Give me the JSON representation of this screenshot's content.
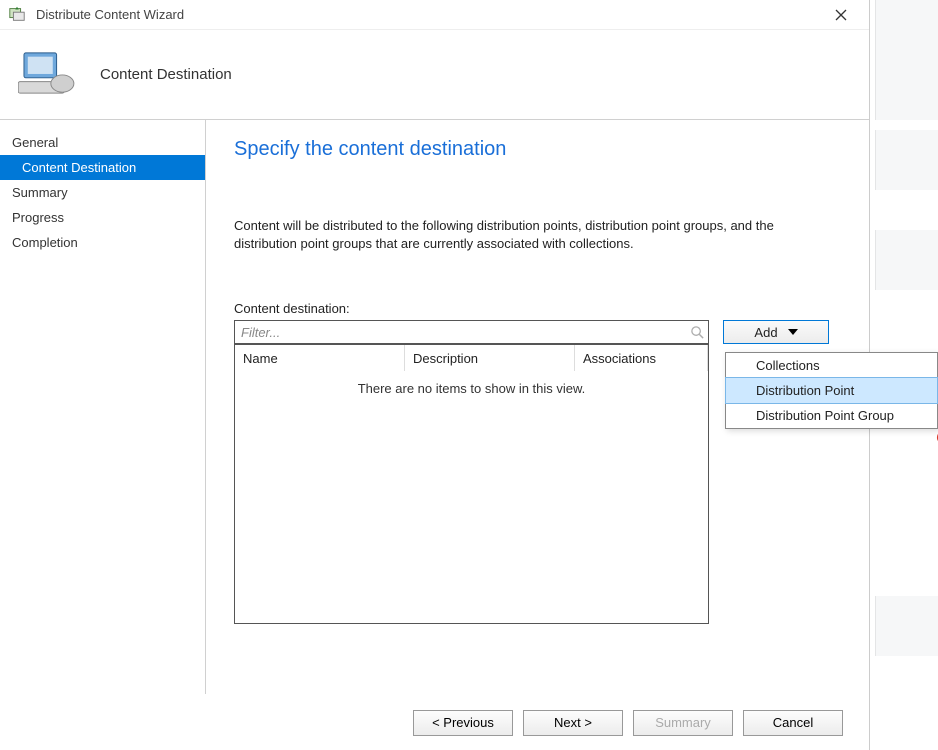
{
  "window": {
    "title": "Distribute Content Wizard",
    "close_aria": "Close"
  },
  "banner": {
    "title": "Content Destination"
  },
  "steps": {
    "items": [
      {
        "label": "General",
        "selected": false
      },
      {
        "label": "Content Destination",
        "selected": true
      },
      {
        "label": "Summary",
        "selected": false
      },
      {
        "label": "Progress",
        "selected": false
      },
      {
        "label": "Completion",
        "selected": false
      }
    ]
  },
  "page": {
    "heading": "Specify the content destination",
    "instructions": "Content will be distributed to the following distribution points, distribution point groups, and the distribution point groups that are currently associated with collections.",
    "field_label": "Content destination:",
    "filter_placeholder": "Filter...",
    "add_label": "Add",
    "columns": {
      "name": "Name",
      "description": "Description",
      "associations": "Associations"
    },
    "empty_text": "There are no items to show in this view."
  },
  "add_menu": {
    "items": [
      {
        "label": "Collections",
        "hover": false
      },
      {
        "label": "Distribution Point",
        "hover": true
      },
      {
        "label": "Distribution Point Group",
        "hover": false
      }
    ]
  },
  "footer": {
    "previous": "< Previous",
    "next": "Next >",
    "summary": "Summary",
    "cancel": "Cancel"
  }
}
